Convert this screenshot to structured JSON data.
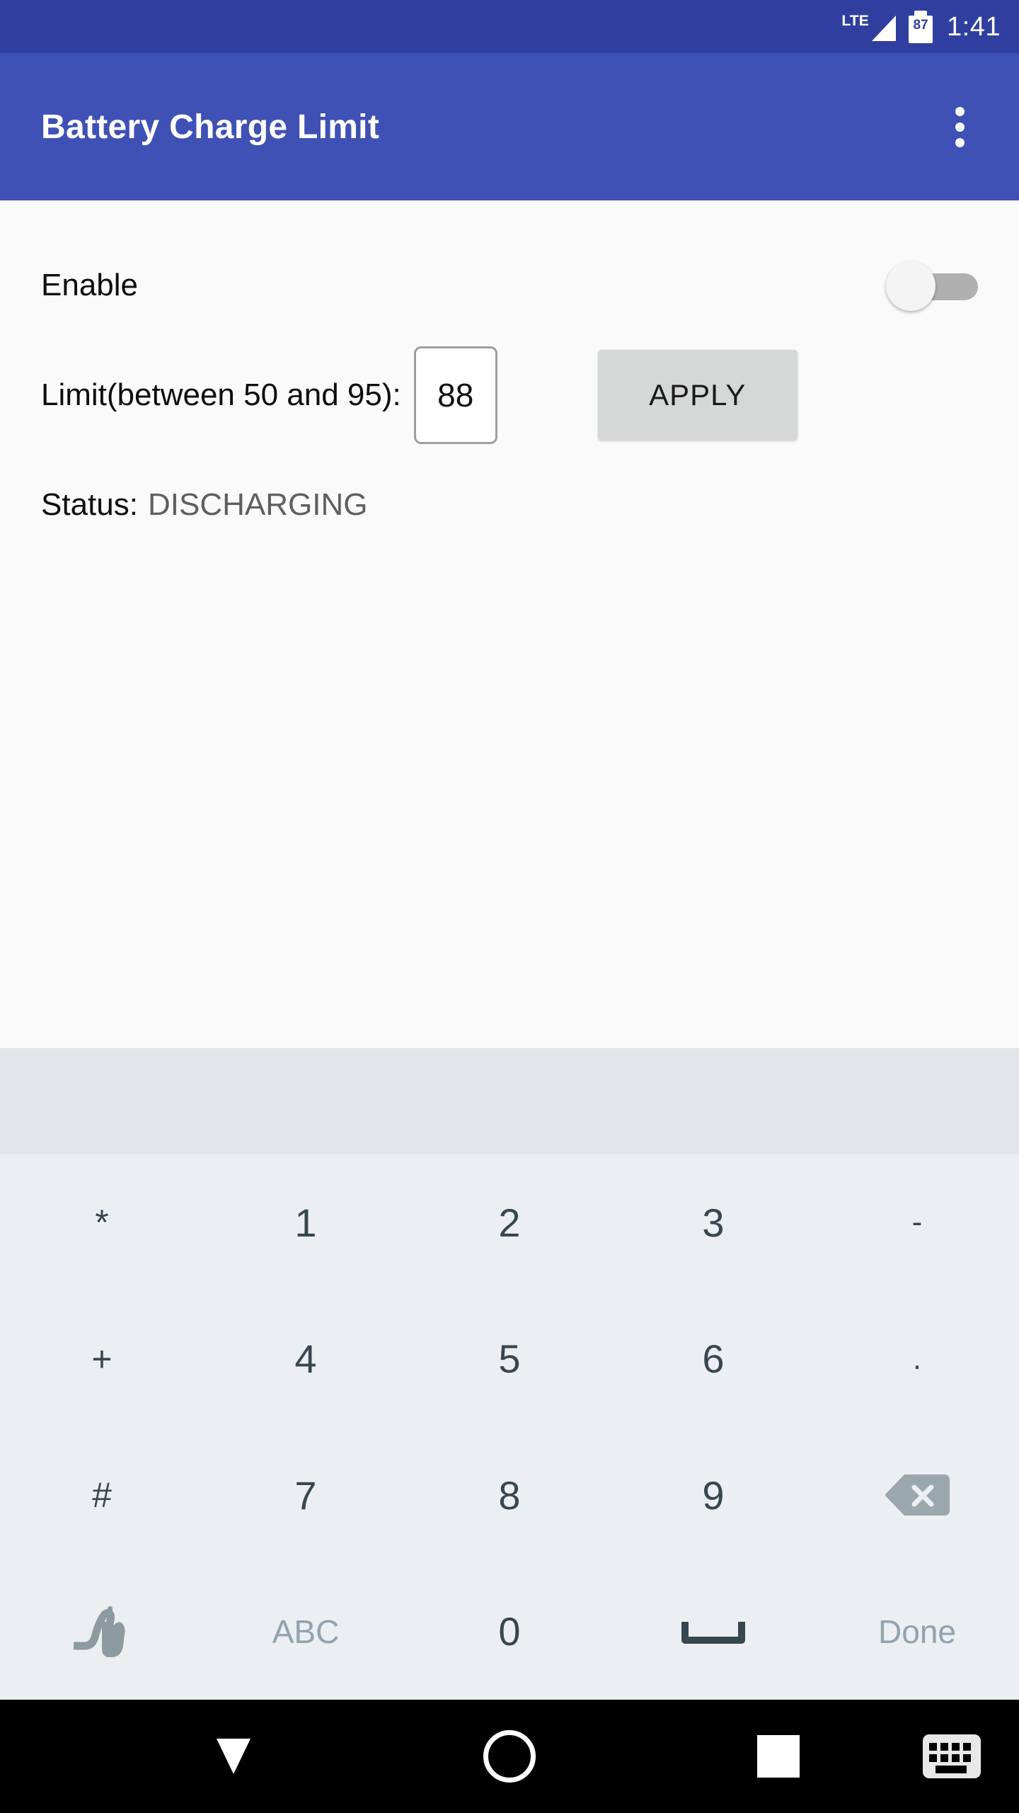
{
  "status_bar": {
    "network_label": "LTE",
    "signal_icon": "signal-triangle-icon",
    "battery_icon": "battery-icon",
    "battery_level": "87",
    "time": "1:41"
  },
  "app_bar": {
    "title": "Battery Charge Limit",
    "overflow_icon": "overflow-menu-icon"
  },
  "content": {
    "enable_label": "Enable",
    "enable_switch_state": "off",
    "limit_label": "Limit(between 50 and 95):",
    "limit_value": "88",
    "limit_placeholder": "",
    "apply_label": "APPLY",
    "status_key": "Status:",
    "status_value": "DISCHARGING"
  },
  "keyboard": {
    "rows": [
      [
        {
          "label": "*",
          "name": "key-asterisk",
          "style": "sym"
        },
        {
          "label": "1",
          "name": "key-1",
          "style": "num"
        },
        {
          "label": "2",
          "name": "key-2",
          "style": "num"
        },
        {
          "label": "3",
          "name": "key-3",
          "style": "num"
        },
        {
          "label": "-",
          "name": "key-hyphen",
          "style": "small-sym"
        }
      ],
      [
        {
          "label": "+",
          "name": "key-plus",
          "style": "sym"
        },
        {
          "label": "4",
          "name": "key-4",
          "style": "num"
        },
        {
          "label": "5",
          "name": "key-5",
          "style": "num"
        },
        {
          "label": "6",
          "name": "key-6",
          "style": "num"
        },
        {
          "label": ".",
          "name": "key-period",
          "style": "small-sym"
        }
      ],
      [
        {
          "label": "#",
          "name": "key-hash",
          "style": "sym"
        },
        {
          "label": "7",
          "name": "key-7",
          "style": "num"
        },
        {
          "label": "8",
          "name": "key-8",
          "style": "num"
        },
        {
          "label": "9",
          "name": "key-9",
          "style": "num"
        },
        {
          "label": "",
          "name": "key-backspace",
          "style": "icon"
        }
      ],
      [
        {
          "label": "",
          "name": "key-handwriting",
          "style": "icon"
        },
        {
          "label": "ABC",
          "name": "key-abc",
          "style": "muted"
        },
        {
          "label": "0",
          "name": "key-0",
          "style": "num"
        },
        {
          "label": "",
          "name": "key-space",
          "style": "icon"
        },
        {
          "label": "Done",
          "name": "key-done",
          "style": "muted"
        }
      ]
    ],
    "key_labels": {
      "r0c0": "*",
      "r0c1": "1",
      "r0c2": "2",
      "r0c3": "3",
      "r0c4": "-",
      "r1c0": "+",
      "r1c1": "4",
      "r1c2": "5",
      "r1c3": "6",
      "r1c4": ".",
      "r2c0": "#",
      "r2c1": "7",
      "r2c2": "8",
      "r2c3": "9",
      "r3c1": "ABC",
      "r3c2": "0",
      "r3c4": "Done"
    }
  },
  "nav_bar": {
    "back_icon": "collapse-keyboard-down-icon",
    "home_icon": "home-circle-icon",
    "recents_icon": "recents-square-icon",
    "keyboard_switcher_icon": "keyboard-switcher-icon"
  },
  "colors": {
    "status_bar_bg": "#303f9f",
    "app_bar_bg": "#3f51b5",
    "content_bg": "#fafafa",
    "suggestion_bg": "#e3e6e8",
    "keyboard_bg": "#eceff1",
    "key_text": "#37474f",
    "key_muted": "#90a4ae",
    "apply_bg": "#d6d7d7",
    "switch_track_off": "#b0b0b0",
    "nav_bar_bg": "#000000"
  }
}
